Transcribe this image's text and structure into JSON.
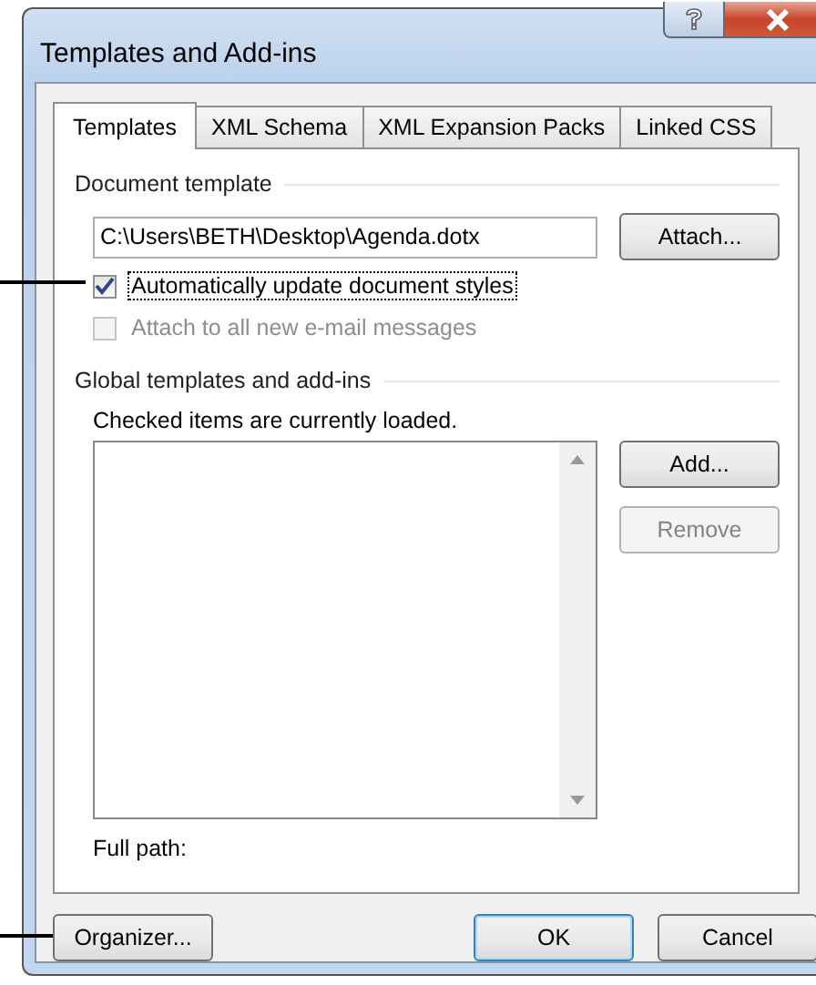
{
  "window": {
    "title": "Templates and Add-ins"
  },
  "tabs": [
    {
      "label": "Templates",
      "selected": true
    },
    {
      "label": "XML Schema",
      "selected": false
    },
    {
      "label": "XML Expansion Packs",
      "selected": false
    },
    {
      "label": "Linked CSS",
      "selected": false
    }
  ],
  "document_template": {
    "heading": "Document template",
    "path": "C:\\Users\\BETH\\Desktop\\Agenda.dotx",
    "attach_button": "Attach...",
    "options": [
      {
        "label": "Automatically update document styles",
        "checked": true,
        "disabled": false,
        "focused": true
      },
      {
        "label": "Attach to all new e-mail messages",
        "checked": false,
        "disabled": true,
        "focused": false
      }
    ]
  },
  "global_templates": {
    "heading": "Global templates and add-ins",
    "note": "Checked items are currently loaded.",
    "buttons": [
      {
        "label": "Add...",
        "disabled": false
      },
      {
        "label": "Remove",
        "disabled": true
      }
    ],
    "full_path_label": "Full path:"
  },
  "footer_buttons": [
    {
      "label": "Organizer...",
      "default": false,
      "kind": "left"
    },
    {
      "label": "OK",
      "default": true,
      "kind": "right"
    },
    {
      "label": "Cancel",
      "default": false,
      "kind": "right"
    }
  ]
}
